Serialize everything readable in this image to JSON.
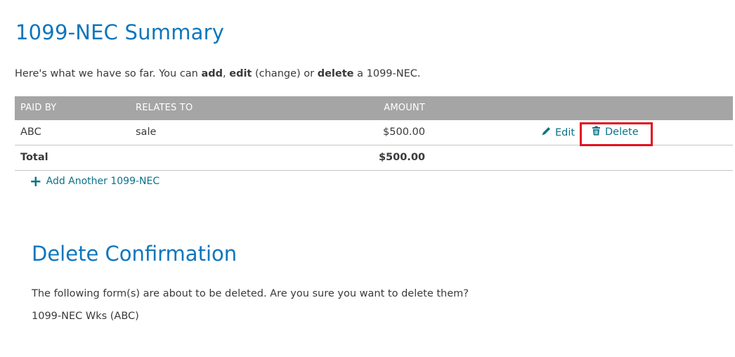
{
  "summary": {
    "title": "1099-NEC Summary",
    "intro": {
      "part1": "Here's what we have so far. You can ",
      "add": "add",
      "sep1": ", ",
      "edit": "edit",
      "part2": " (change) or ",
      "delete": "delete",
      "part3": " a 1099-NEC."
    }
  },
  "table": {
    "headers": [
      "PAID BY",
      "RELATES TO",
      "AMOUNT"
    ],
    "rows": [
      {
        "paid_by": "ABC",
        "relates_to": "sale",
        "amount": "$500.00",
        "edit_label": "Edit",
        "delete_label": "Delete"
      }
    ],
    "total_label": "Total",
    "total_amount": "$500.00"
  },
  "add_another_label": "Add Another 1099-NEC",
  "icons": {
    "edit": "pencil-icon",
    "delete": "trash-icon",
    "add": "plus-icon"
  },
  "colors": {
    "heading": "#0d76bd",
    "link": "#0a7389",
    "header_bg": "#a5a5a5",
    "highlight": "#e3101f"
  },
  "confirmation": {
    "title": "Delete Confirmation",
    "message": "The following form(s) are about to be deleted. Are you sure you want to delete them?",
    "forms": [
      "1099-NEC Wks (ABC)"
    ]
  }
}
